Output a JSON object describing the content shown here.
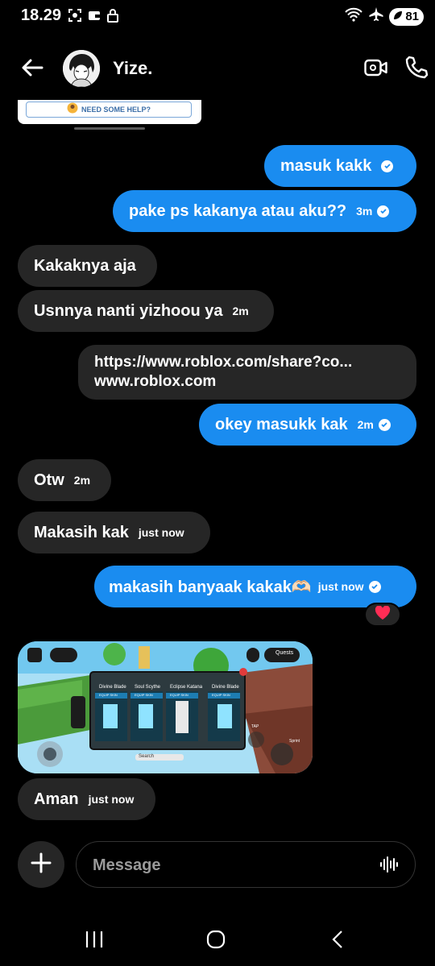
{
  "status_bar": {
    "time": "18.29",
    "battery": "81"
  },
  "header": {
    "name": "Yize."
  },
  "shared_card": {
    "help_text": "NEED SOME HELP?"
  },
  "messages": [
    {
      "dir": "out",
      "text": "masuk kakk",
      "time": ""
    },
    {
      "dir": "out",
      "text": "pake ps kakanya atau aku??",
      "time": "3m"
    },
    {
      "dir": "in",
      "text": "Kakaknya aja",
      "time": ""
    },
    {
      "dir": "in",
      "text": "Usnnya nanti yizhoou ya",
      "time": "2m"
    },
    {
      "dir": "out",
      "link_url": "https://www.roblox.com/share?co...",
      "link_domain": "www.roblox.com"
    },
    {
      "dir": "out",
      "text": "okey masukk kak",
      "time": "2m"
    },
    {
      "dir": "in",
      "text": "Otw",
      "time": "2m"
    },
    {
      "dir": "in",
      "text": "Makasih kak",
      "time": "just now"
    },
    {
      "dir": "out",
      "text": "makasih banyaak kakak🫶🏻",
      "time": "just now",
      "reaction": "❤️"
    },
    {
      "dir": "in",
      "text": "Aman",
      "time": "just now"
    }
  ],
  "media": {
    "items": [
      "Divine Blade",
      "Soul Scythe",
      "Eclipse Katana",
      "Divine Blade"
    ],
    "equip_label": "EQUIP SKIN",
    "search_label": "Search",
    "quests_label": "Quests",
    "tap_label": "TAP",
    "sprint_label": "Sprint"
  },
  "composer": {
    "placeholder": "Message"
  },
  "colors": {
    "outgoing": "#1a8cf0",
    "incoming": "#262626",
    "background": "#000000"
  }
}
